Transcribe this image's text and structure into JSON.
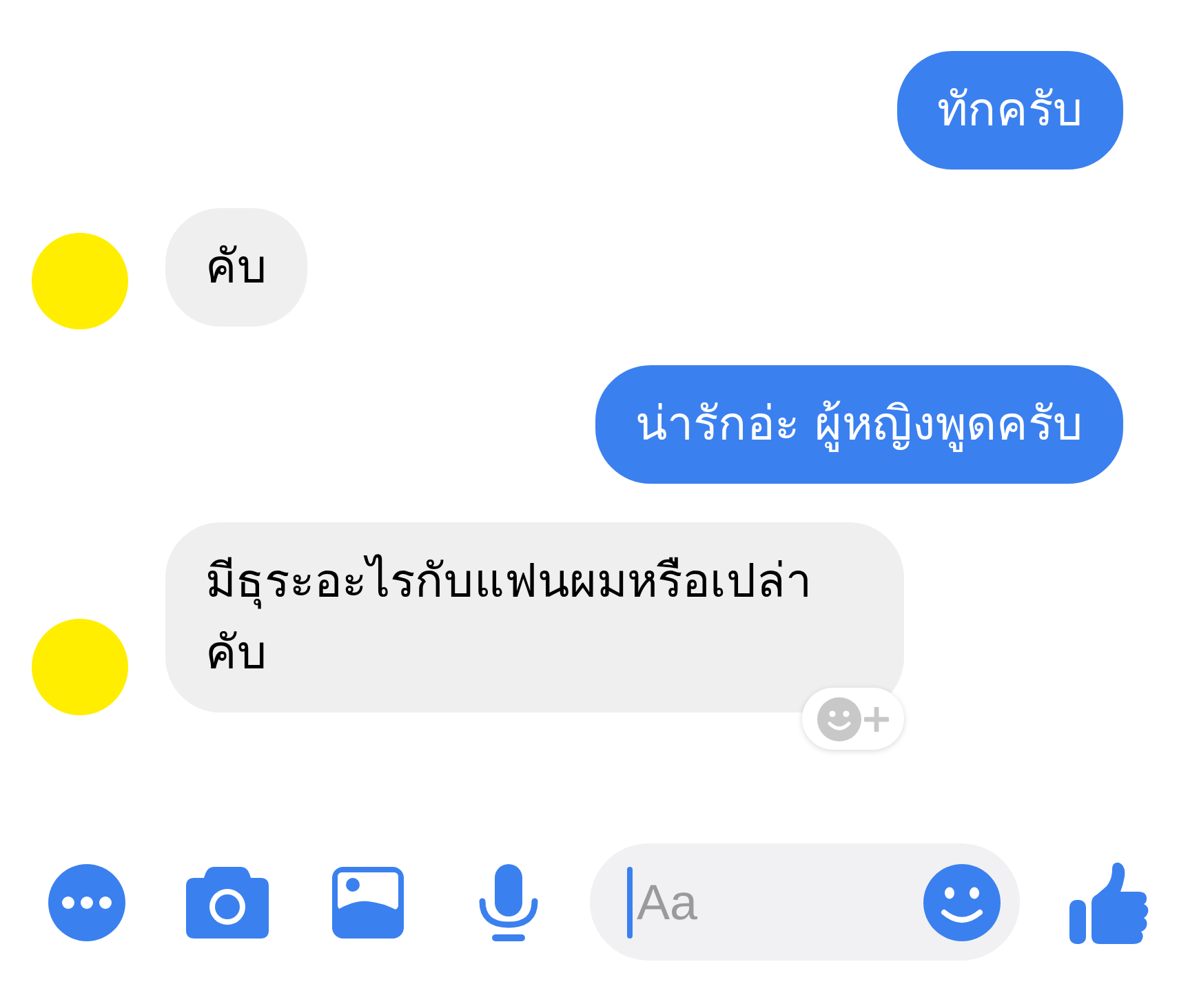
{
  "messages": [
    {
      "kind": "sent",
      "text": "ทักครับ"
    },
    {
      "kind": "received",
      "text": "คับ",
      "reaction_button": false
    },
    {
      "kind": "sent",
      "text": "น่ารักอ่ะ ผู้หญิงพูดครับ"
    },
    {
      "kind": "received",
      "text": "มีธุระอะไรกับแฟนผมหรือเปล่าคับ",
      "reaction_button": true
    }
  ],
  "composer": {
    "placeholder": "Aa"
  }
}
